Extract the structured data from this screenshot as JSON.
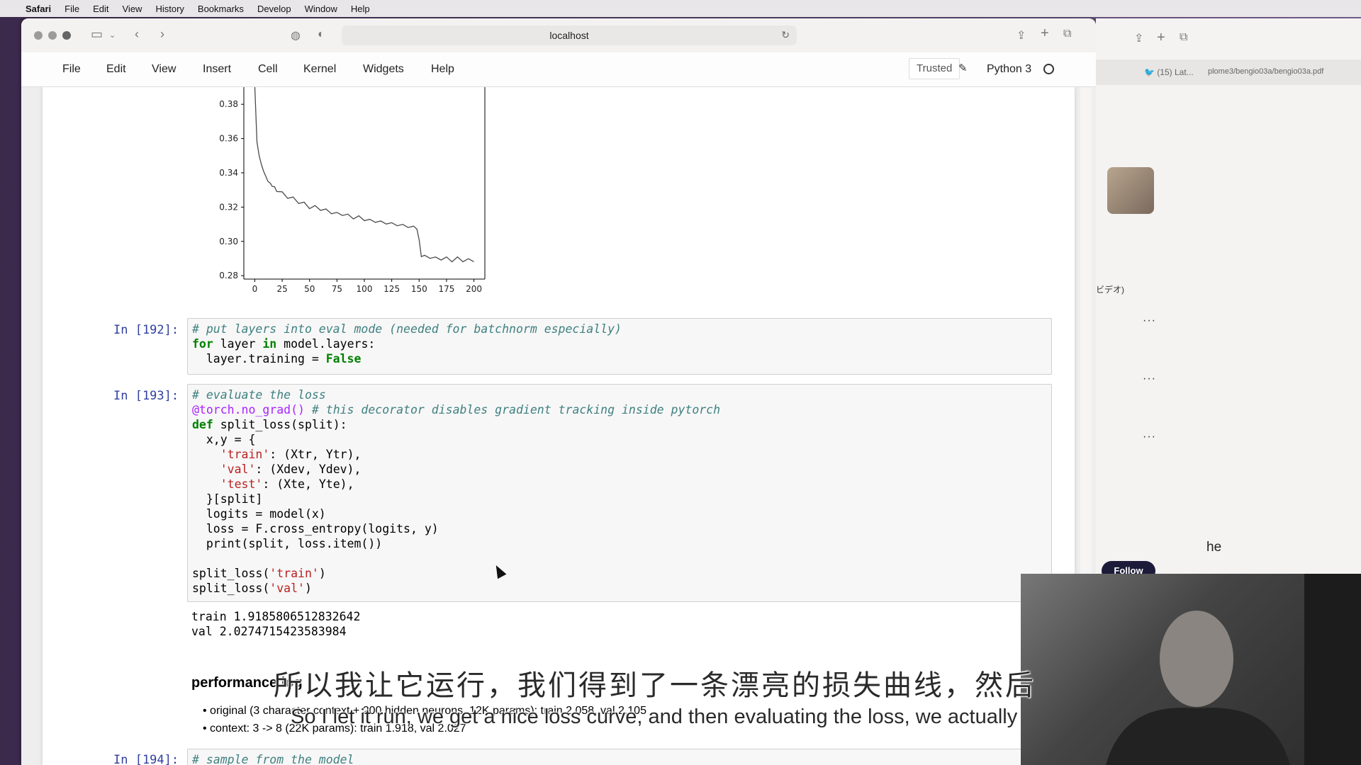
{
  "menubar": {
    "app": "Safari",
    "items": [
      "File",
      "Edit",
      "View",
      "History",
      "Bookmarks",
      "Develop",
      "Window",
      "Help"
    ]
  },
  "browser": {
    "url": "localhost",
    "tab2_label": "(15) Lat...",
    "tab2_url": "plome3/bengio03a/bengio03a.pdf"
  },
  "jupyter": {
    "menu": [
      "File",
      "Edit",
      "View",
      "Insert",
      "Cell",
      "Kernel",
      "Widgets",
      "Help"
    ],
    "trusted": "Trusted",
    "kernel": "Python 3"
  },
  "chart_data": {
    "type": "line",
    "title": "",
    "xlabel": "",
    "ylabel": "",
    "xticks": [
      0,
      25,
      50,
      75,
      100,
      125,
      150,
      175,
      200
    ],
    "yticks": [
      0.28,
      0.3,
      0.32,
      0.34,
      0.36,
      0.38
    ],
    "xlim": [
      -10,
      210
    ],
    "ylim": [
      0.278,
      0.39
    ],
    "series": [
      {
        "x": [
          0,
          2,
          4,
          6,
          8,
          10,
          12,
          14,
          16,
          18,
          20,
          25,
          30,
          35,
          40,
          45,
          50,
          55,
          60,
          65,
          70,
          75,
          80,
          85,
          90,
          95,
          100,
          105,
          110,
          115,
          120,
          125,
          130,
          135,
          140,
          145,
          148,
          150,
          152,
          155,
          160,
          165,
          170,
          175,
          180,
          185,
          190,
          195,
          200
        ],
        "values": [
          0.39,
          0.358,
          0.35,
          0.345,
          0.341,
          0.338,
          0.335,
          0.334,
          0.332,
          0.331,
          0.33,
          0.328,
          0.326,
          0.325,
          0.323,
          0.322,
          0.32,
          0.32,
          0.319,
          0.318,
          0.317,
          0.316,
          0.316,
          0.315,
          0.314,
          0.314,
          0.313,
          0.312,
          0.312,
          0.311,
          0.311,
          0.31,
          0.31,
          0.309,
          0.309,
          0.308,
          0.308,
          0.3,
          0.292,
          0.291,
          0.291,
          0.29,
          0.29,
          0.29,
          0.289,
          0.29,
          0.289,
          0.289,
          0.289
        ]
      }
    ]
  },
  "cells": {
    "c192": {
      "prompt": "In [192]:",
      "code": "",
      "l1": "# put layers into eval mode (needed for batchnorm especially)",
      "l2a": "for",
      "l2b": " layer ",
      "l2c": "in",
      "l2d": " model.layers:",
      "l3a": "  layer.training = ",
      "l3b": "False"
    },
    "c193": {
      "prompt": "In [193]:",
      "l1": "# evaluate the loss",
      "l2a": "@torch.no_grad()",
      "l2b": " # this decorator disables gradient tracking inside pytorch",
      "l3a": "def",
      "l3b": " split_loss(split):",
      "l4": "  x,y = {",
      "l5a": "    ",
      "l5b": "'train'",
      "l5c": ": (Xtr, Ytr),",
      "l6b": "'val'",
      "l6c": ": (Xdev, Ydev),",
      "l7b": "'test'",
      "l7c": ": (Xte, Yte),",
      "l8": "  }[split]",
      "l9": "  logits = model(x)",
      "l10": "  loss = F.cross_entropy(logits, y)",
      "l11": "  print(split, loss.item())",
      "l13a": "split_loss(",
      "l13b": "'train'",
      "l13c": ")",
      "l14b": "'val'",
      "out1": "train 1.9185806512832642",
      "out2": "val 2.0274715423583984"
    },
    "md": {
      "heading": "performance log",
      "li1": "original (3 character context + 200 hidden neurons, 12K params): train 2.058, val 2.105",
      "li2": "context: 3 -> 8 (22K params): train 1.918, val 2.027"
    },
    "c194": {
      "prompt": "In [194]:",
      "l1": "# sample from the model"
    }
  },
  "side": {
    "jp_text": "ビデオ)",
    "he_text": "he",
    "follow": "Follow"
  },
  "subtitles": {
    "zh": "所以我让它运行，我们得到了一条漂亮的损失曲线，然后",
    "en": "So I let it run, we get a nice loss curve, and then evaluating the loss, we actually"
  }
}
